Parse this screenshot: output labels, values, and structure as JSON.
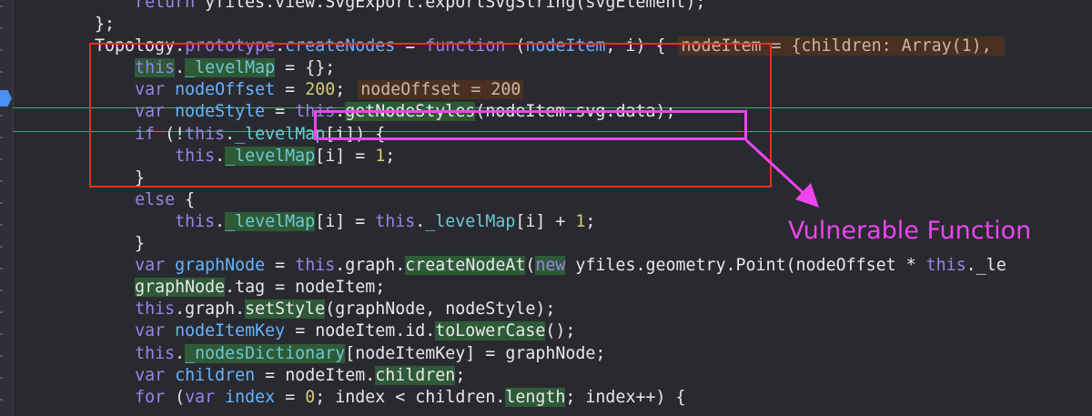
{
  "editor": {
    "lines": [
      {
        "segs": [
          {
            "t": "        "
          },
          {
            "t": "return",
            "c": "kw"
          },
          {
            "t": " yfiles.view.SvgExport.exportSvgString(svgElement);"
          }
        ]
      },
      {
        "segs": [
          {
            "t": "    };"
          }
        ]
      },
      {
        "segs": [
          {
            "t": "    Topology."
          },
          {
            "t": "prototype",
            "c": "kw"
          },
          {
            "t": "."
          },
          {
            "t": "createNodes",
            "c": "fn"
          },
          {
            "t": " = "
          },
          {
            "t": "function",
            "c": "kw"
          },
          {
            "t": " ("
          },
          {
            "t": "nodeItem",
            "c": "fn"
          },
          {
            "t": ", i) {"
          },
          {
            "t": "nodeItem = {children: Array(1), ",
            "c": "inline-val"
          }
        ]
      },
      {
        "segs": [
          {
            "t": "        "
          },
          {
            "t": "this",
            "c": "kw hl"
          },
          {
            "t": "."
          },
          {
            "t": "_levelMap",
            "c": "prop hl"
          },
          {
            "t": " = {};"
          }
        ]
      },
      {
        "segs": [
          {
            "t": "        "
          },
          {
            "t": "var",
            "c": "kw"
          },
          {
            "t": " "
          },
          {
            "t": "nodeOffset",
            "c": "fn"
          },
          {
            "t": " = "
          },
          {
            "t": "200",
            "c": "num"
          },
          {
            "t": ";"
          },
          {
            "t": "nodeOffset = 200",
            "c": "inline-val"
          }
        ]
      },
      {
        "segs": [
          {
            "t": "        "
          },
          {
            "t": "var",
            "c": "kw"
          },
          {
            "t": " "
          },
          {
            "t": "nodeStyle",
            "c": "fn"
          },
          {
            "t": " = "
          },
          {
            "t": "this",
            "c": "kw"
          },
          {
            "t": "."
          },
          {
            "t": "getNodeStyles",
            "c": "call hl"
          },
          {
            "t": "(nodeItem."
          },
          {
            "t": "svg",
            "c": "call"
          },
          {
            "t": "."
          },
          {
            "t": "data",
            "c": "call"
          },
          {
            "t": ");"
          }
        ]
      },
      {
        "segs": [
          {
            "t": "        "
          },
          {
            "t": "if",
            "c": "kw"
          },
          {
            "t": " (!"
          },
          {
            "t": "this",
            "c": "kw"
          },
          {
            "t": "."
          },
          {
            "t": "_levelMap",
            "c": "prop"
          },
          {
            "t": "[i]) {"
          }
        ]
      },
      {
        "segs": [
          {
            "t": "            "
          },
          {
            "t": "this",
            "c": "kw"
          },
          {
            "t": "."
          },
          {
            "t": "_levelMap",
            "c": "prop hl"
          },
          {
            "t": "[i] = "
          },
          {
            "t": "1",
            "c": "num"
          },
          {
            "t": ";"
          }
        ]
      },
      {
        "segs": [
          {
            "t": "        }"
          }
        ]
      },
      {
        "segs": [
          {
            "t": "        "
          },
          {
            "t": "else",
            "c": "kw"
          },
          {
            "t": " {"
          }
        ]
      },
      {
        "segs": [
          {
            "t": "            "
          },
          {
            "t": "this",
            "c": "kw"
          },
          {
            "t": "."
          },
          {
            "t": "_levelMap",
            "c": "prop hl"
          },
          {
            "t": "[i] = "
          },
          {
            "t": "this",
            "c": "kw"
          },
          {
            "t": "."
          },
          {
            "t": "_levelMap",
            "c": "prop"
          },
          {
            "t": "[i] + "
          },
          {
            "t": "1",
            "c": "num"
          },
          {
            "t": ";"
          }
        ]
      },
      {
        "segs": [
          {
            "t": "        }"
          }
        ]
      },
      {
        "segs": [
          {
            "t": "        "
          },
          {
            "t": "var",
            "c": "kw"
          },
          {
            "t": " "
          },
          {
            "t": "graphNode",
            "c": "fn"
          },
          {
            "t": " = "
          },
          {
            "t": "this",
            "c": "kw"
          },
          {
            "t": ".graph."
          },
          {
            "t": "createNodeAt",
            "c": "call hl"
          },
          {
            "t": "("
          },
          {
            "t": "new",
            "c": "kw hl"
          },
          {
            "t": " yfiles.geometry.Point(nodeOffset * "
          },
          {
            "t": "this",
            "c": "kw"
          },
          {
            "t": "._le"
          }
        ]
      },
      {
        "segs": [
          {
            "t": "        "
          },
          {
            "t": "graphNode",
            "c": "call hl"
          },
          {
            "t": ".tag = nodeItem;"
          }
        ]
      },
      {
        "segs": [
          {
            "t": "        "
          },
          {
            "t": "this",
            "c": "kw"
          },
          {
            "t": ".graph."
          },
          {
            "t": "setStyle",
            "c": "call hl"
          },
          {
            "t": "(graphNode, nodeStyle);"
          }
        ]
      },
      {
        "segs": [
          {
            "t": "        "
          },
          {
            "t": "var",
            "c": "kw"
          },
          {
            "t": " "
          },
          {
            "t": "nodeItemKey",
            "c": "fn"
          },
          {
            "t": " = nodeItem.id."
          },
          {
            "t": "toLowerCase",
            "c": "call hl"
          },
          {
            "t": "();"
          }
        ]
      },
      {
        "segs": [
          {
            "t": "        "
          },
          {
            "t": "this",
            "c": "kw"
          },
          {
            "t": "."
          },
          {
            "t": "_nodesDictionary",
            "c": "prop hl"
          },
          {
            "t": "[nodeItemKey] = graphNode;"
          }
        ]
      },
      {
        "segs": [
          {
            "t": "        "
          },
          {
            "t": "var",
            "c": "kw"
          },
          {
            "t": " "
          },
          {
            "t": "children",
            "c": "fn"
          },
          {
            "t": " = nodeItem."
          },
          {
            "t": "children",
            "c": "call hl"
          },
          {
            "t": ";"
          }
        ]
      },
      {
        "segs": [
          {
            "t": "        "
          },
          {
            "t": "for",
            "c": "kw"
          },
          {
            "t": " ("
          },
          {
            "t": "var",
            "c": "kw"
          },
          {
            "t": " "
          },
          {
            "t": "index",
            "c": "fn"
          },
          {
            "t": " = "
          },
          {
            "t": "0",
            "c": "num"
          },
          {
            "t": "; index < children."
          },
          {
            "t": "length",
            "c": "call hl"
          },
          {
            "t": "; index++) {"
          }
        ]
      }
    ]
  },
  "annotation": {
    "label": "Vulnerable Function",
    "color": "#ee44f0",
    "outer_box_color": "#e8301f"
  },
  "breakpoint": {
    "icon": "breakpoint-marker-icon",
    "color": "#4a8ff4"
  }
}
